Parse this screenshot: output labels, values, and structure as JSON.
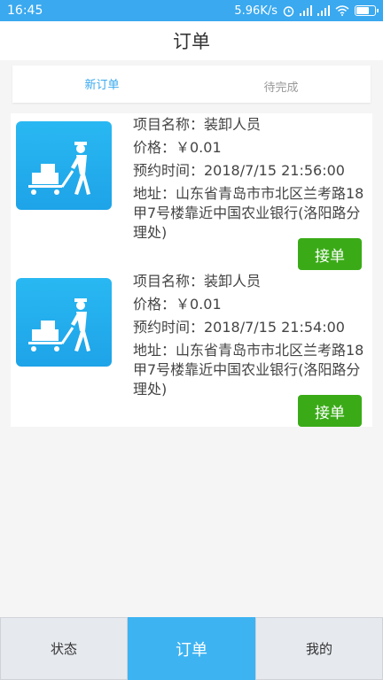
{
  "status_bar": {
    "time": "16:45",
    "speed": "5.96K/s"
  },
  "header": {
    "title": "订单"
  },
  "tabs": [
    {
      "label": "新订单",
      "active": true
    },
    {
      "label": "待完成",
      "active": false
    }
  ],
  "orders": [
    {
      "project": "项目名称：装卸人员",
      "price": "价格：￥0.01",
      "time": "预约时间：2018/7/15 21:56:00",
      "address": "地址：山东省青岛市市北区兰考路18甲7号楼靠近中国农业银行(洛阳路分理处)",
      "accept_label": "接单"
    },
    {
      "project": "项目名称：装卸人员",
      "price": "价格：￥0.01",
      "time": "预约时间：2018/7/15 21:54:00",
      "address": "地址：山东省青岛市市北区兰考路18甲7号楼靠近中国农业银行(洛阳路分理处)",
      "accept_label": "接单"
    }
  ],
  "bottom_nav": [
    {
      "label": "状态",
      "active": false
    },
    {
      "label": "订单",
      "active": true
    },
    {
      "label": "我的",
      "active": false
    }
  ],
  "colors": {
    "accent": "#3aa9ef",
    "accept_button": "#3aab17",
    "nav_active": "#3db3f2"
  }
}
